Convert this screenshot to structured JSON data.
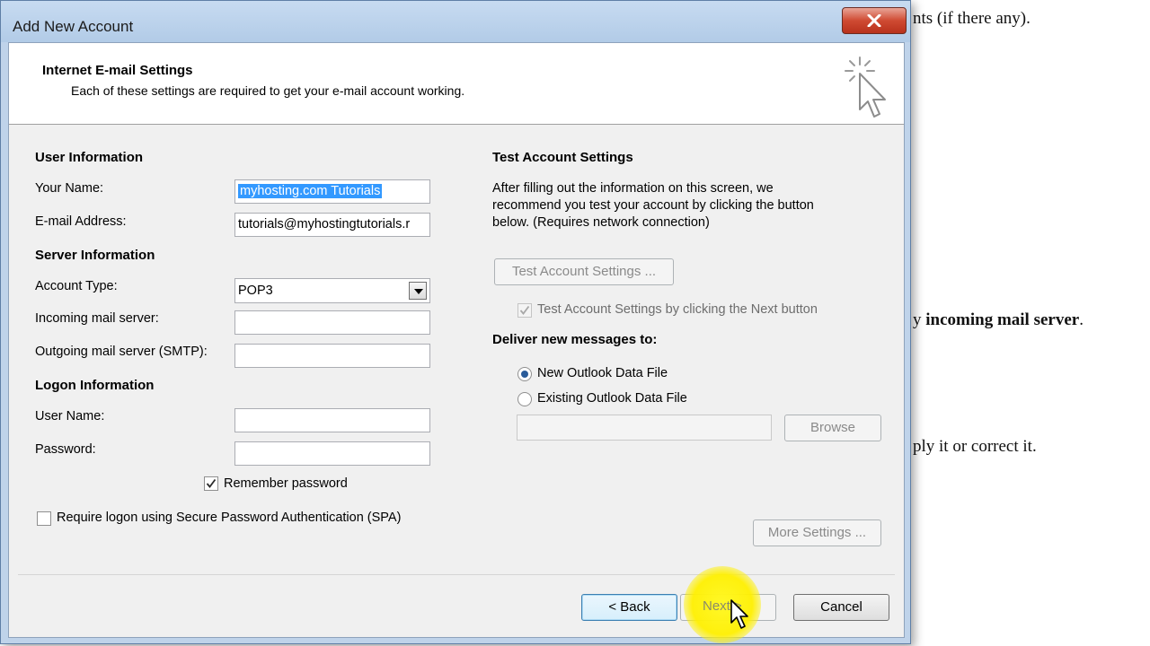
{
  "background_doc": {
    "line1": "nts (if there any).",
    "line2_prefix": "y ",
    "line2_bold": "incoming mail server",
    "line2_suffix": ".",
    "line3": "ply it or correct it."
  },
  "window": {
    "title": "Add New Account"
  },
  "header": {
    "title": "Internet E-mail Settings",
    "subtitle": "Each of these settings are required to get your e-mail account working."
  },
  "user_info": {
    "heading": "User Information",
    "your_name_label": "Your Name:",
    "your_name_value": "myhosting.com Tutorials",
    "email_label": "E-mail Address:",
    "email_value": "tutorials@myhostingtutorials.r"
  },
  "server_info": {
    "heading": "Server Information",
    "account_type_label": "Account Type:",
    "account_type_value": "POP3",
    "incoming_label": "Incoming mail server:",
    "incoming_value": "",
    "outgoing_label": "Outgoing mail server (SMTP):",
    "outgoing_value": ""
  },
  "logon_info": {
    "heading": "Logon Information",
    "username_label": "User Name:",
    "username_value": "",
    "password_label": "Password:",
    "password_value": "",
    "remember_label": "Remember password",
    "remember_checked": true,
    "spa_label": "Require logon using Secure Password Authentication (SPA)",
    "spa_checked": false
  },
  "test_settings": {
    "heading": "Test Account Settings",
    "description_line1": "After filling out the information on this screen, we",
    "description_line2": "recommend you test your account by clicking the button",
    "description_line3": "below. (Requires network connection)",
    "test_button": "Test Account Settings ...",
    "next_check_label": "Test Account Settings by clicking the Next button",
    "next_check_checked": true
  },
  "deliver": {
    "heading": "Deliver new messages to:",
    "option_new": "New Outlook Data File",
    "option_existing": "Existing Outlook Data File",
    "selected": "New Outlook Data File",
    "existing_path": "",
    "browse_button": "Browse"
  },
  "more_settings_button": "More Settings ...",
  "footer": {
    "back_button": "< Back",
    "next_button": "Next >",
    "cancel_button": "Cancel"
  },
  "colors": {
    "window_frame": "#bfd3ea",
    "selection": "#3399ff",
    "highlight_spot": "#fff200"
  }
}
